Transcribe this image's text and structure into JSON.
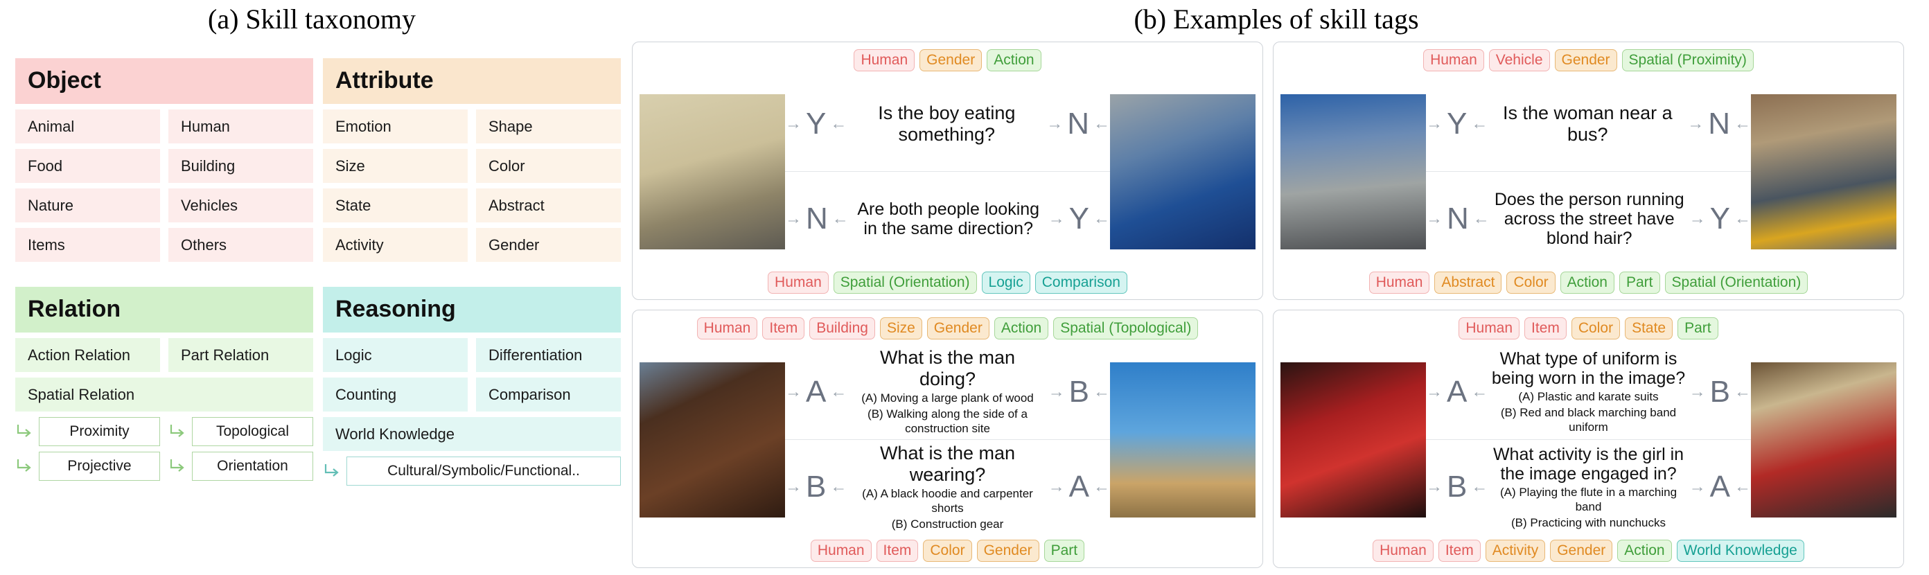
{
  "captions": {
    "a": "(a) Skill taxonomy",
    "b": "(b) Examples of skill tags"
  },
  "colors": {
    "object_header": "#fbd2d2",
    "object_cell": "#fdeceb",
    "attribute_header": "#fae6cd",
    "attribute_cell": "#fdf3e8",
    "relation_header": "#d2f0ca",
    "relation_cell": "#e8f8e3",
    "reasoning_header": "#c3efea",
    "reasoning_cell": "#e2f7f4",
    "tag_object_text": "#e05a5a",
    "tag_attribute_text": "#e08a22",
    "tag_relation_text": "#3f9e3a",
    "tag_reasoning_text": "#16a093"
  },
  "taxonomy": {
    "object": {
      "title": "Object",
      "cells": [
        "Animal",
        "Human",
        "Food",
        "Building",
        "Nature",
        "Vehicles",
        "Items",
        "Others"
      ]
    },
    "attribute": {
      "title": "Attribute",
      "cells": [
        "Emotion",
        "Shape",
        "Size",
        "Color",
        "State",
        "Abstract",
        "Activity",
        "Gender"
      ]
    },
    "relation": {
      "title": "Relation",
      "cells": [
        "Action Relation",
        "Part Relation"
      ],
      "full_cell": "Spatial Relation",
      "subnodes": [
        "Proximity",
        "Topological",
        "Projective",
        "Orientation"
      ],
      "arrow_icon": "arrow-branch-icon"
    },
    "reasoning": {
      "title": "Reasoning",
      "cells": [
        "Logic",
        "Differentiation",
        "Counting",
        "Comparison"
      ],
      "full_cell": "World Knowledge",
      "subnodes": [
        "Cultural/Symbolic/Functional.."
      ],
      "arrow_icon": "arrow-branch-icon"
    }
  },
  "examples": [
    {
      "id": "example-top-left",
      "top_tags": [
        {
          "label": "Human",
          "group": "object"
        },
        {
          "label": "Gender",
          "group": "attribute"
        },
        {
          "label": "Action",
          "group": "relation"
        }
      ],
      "bottom_tags": [
        {
          "label": "Human",
          "group": "object"
        },
        {
          "label": "Spatial (Orientation)",
          "group": "relation"
        },
        {
          "label": "Logic",
          "group": "reasoning"
        },
        {
          "label": "Comparison",
          "group": "reasoning"
        }
      ],
      "left_image": "photo-woman-and-boy-by-wall",
      "right_image": "photo-boy-and-woman-in-blue",
      "rows": [
        {
          "question": "Is the boy eating something?",
          "options": [],
          "left_answer": "Y",
          "right_answer": "N"
        },
        {
          "question": "Are both people looking in the same direction?",
          "options": [],
          "left_answer": "N",
          "right_answer": "Y"
        }
      ]
    },
    {
      "id": "example-top-right",
      "top_tags": [
        {
          "label": "Human",
          "group": "object"
        },
        {
          "label": "Vehicle",
          "group": "object"
        },
        {
          "label": "Gender",
          "group": "attribute"
        },
        {
          "label": "Spatial (Proximity)",
          "group": "relation"
        }
      ],
      "bottom_tags": [
        {
          "label": "Human",
          "group": "object"
        },
        {
          "label": "Abstract",
          "group": "attribute"
        },
        {
          "label": "Color",
          "group": "attribute"
        },
        {
          "label": "Action",
          "group": "relation"
        },
        {
          "label": "Part",
          "group": "relation"
        },
        {
          "label": "Spatial (Orientation)",
          "group": "relation"
        }
      ],
      "left_image": "photo-street-with-bus-and-pedestrian",
      "right_image": "photo-blond-woman-crossing-street",
      "rows": [
        {
          "question": "Is the woman near a bus?",
          "options": [],
          "left_answer": "Y",
          "right_answer": "N"
        },
        {
          "question": "Does the person running across the street have blond hair?",
          "options": [],
          "left_answer": "N",
          "right_answer": "Y"
        }
      ]
    },
    {
      "id": "example-bottom-left",
      "top_tags": [
        {
          "label": "Human",
          "group": "object"
        },
        {
          "label": "Item",
          "group": "object"
        },
        {
          "label": "Building",
          "group": "object"
        },
        {
          "label": "Size",
          "group": "attribute"
        },
        {
          "label": "Gender",
          "group": "attribute"
        },
        {
          "label": "Action",
          "group": "relation"
        },
        {
          "label": "Spatial (Topological)",
          "group": "relation"
        }
      ],
      "bottom_tags": [
        {
          "label": "Human",
          "group": "object"
        },
        {
          "label": "Item",
          "group": "object"
        },
        {
          "label": "Color",
          "group": "attribute"
        },
        {
          "label": "Gender",
          "group": "attribute"
        },
        {
          "label": "Part",
          "group": "relation"
        }
      ],
      "left_image": "photo-worker-carrying-plank",
      "right_image": "photo-crane-at-construction-site",
      "rows": [
        {
          "question": "What is the man doing?",
          "options": [
            "(A) Moving a large plank of wood",
            "(B) Walking along the side of a construction site"
          ],
          "left_answer": "A",
          "right_answer": "B"
        },
        {
          "question": "What is the man wearing?",
          "options": [
            "(A) A black hoodie and carpenter shorts",
            "(B) Construction gear"
          ],
          "left_answer": "B",
          "right_answer": "A"
        }
      ]
    },
    {
      "id": "example-bottom-right",
      "top_tags": [
        {
          "label": "Human",
          "group": "object"
        },
        {
          "label": "Item",
          "group": "object"
        },
        {
          "label": "Color",
          "group": "attribute"
        },
        {
          "label": "State",
          "group": "attribute"
        },
        {
          "label": "Part",
          "group": "relation"
        }
      ],
      "bottom_tags": [
        {
          "label": "Human",
          "group": "object"
        },
        {
          "label": "Item",
          "group": "object"
        },
        {
          "label": "Activity",
          "group": "attribute"
        },
        {
          "label": "Gender",
          "group": "attribute"
        },
        {
          "label": "Action",
          "group": "relation"
        },
        {
          "label": "World Knowledge",
          "group": "reasoning"
        }
      ],
      "left_image": "photo-performers-in-red-with-sticks",
      "right_image": "photo-marching-band-flute-player",
      "rows": [
        {
          "question": "What type of uniform is being worn in the image?",
          "options": [
            "(A) Plastic and karate suits",
            "(B) Red and black marching band uniform"
          ],
          "left_answer": "A",
          "right_answer": "B"
        },
        {
          "question": "What activity is the girl in the image engaged in?",
          "options": [
            "(A) Playing the flute in a marching band",
            "(B) Practicing with nunchucks"
          ],
          "left_answer": "B",
          "right_answer": "A"
        }
      ]
    }
  ]
}
